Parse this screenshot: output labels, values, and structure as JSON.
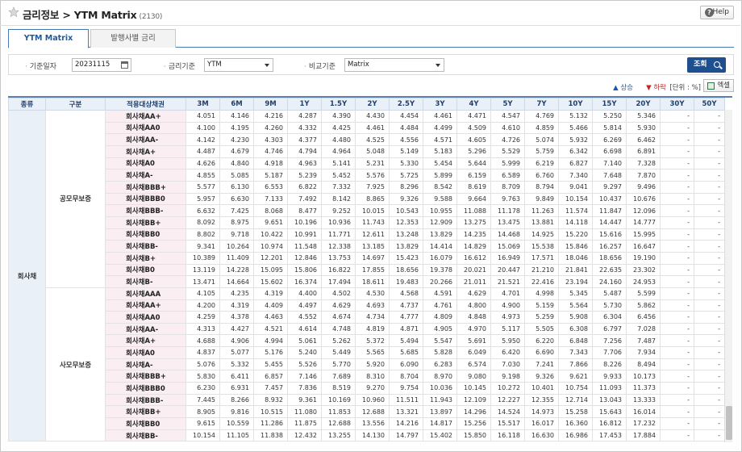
{
  "header": {
    "title": "금리정보 > YTM Matrix",
    "code": "(2130)",
    "help_label": "Help"
  },
  "tabs": [
    {
      "label": "YTM Matrix",
      "active": true
    },
    {
      "label": "발행사별 금리",
      "active": false
    }
  ],
  "filters": {
    "date_label": "기준일자",
    "date_value": "20231115",
    "rate_label": "금리기준",
    "rate_value": "YTM",
    "compare_label": "비교기준",
    "compare_value": "Matrix",
    "search_label": "조회"
  },
  "legend": {
    "up": "▲ 상승",
    "down": "▼ 하락",
    "unit": "[단위 : %]",
    "excel_label": "엑셀"
  },
  "colors": {
    "accent": "#1e4f8f",
    "header_bg": "#eaf0f8",
    "bond_bg": "#fbeef3",
    "up": "#1e56b4",
    "down": "#c82222"
  },
  "table": {
    "columns": [
      "종류",
      "구분",
      "적용대상채권",
      "3M",
      "6M",
      "9M",
      "1Y",
      "1.5Y",
      "2Y",
      "2.5Y",
      "3Y",
      "4Y",
      "5Y",
      "7Y",
      "10Y",
      "15Y",
      "20Y",
      "30Y",
      "50Y"
    ],
    "kind": "회사채",
    "groups": [
      {
        "name": "공모무보증",
        "rows": [
          {
            "bond": "회사채AA+",
            "values": [
              "4.051",
              "4.146",
              "4.216",
              "4.287",
              "4.390",
              "4.430",
              "4.454",
              "4.461",
              "4.471",
              "4.547",
              "4.769",
              "5.132",
              "5.250",
              "5.346",
              "-",
              "-"
            ]
          },
          {
            "bond": "회사채AA0",
            "values": [
              "4.100",
              "4.195",
              "4.260",
              "4.332",
              "4.425",
              "4.461",
              "4.484",
              "4.499",
              "4.509",
              "4.610",
              "4.859",
              "5.466",
              "5.814",
              "5.930",
              "-",
              "-"
            ]
          },
          {
            "bond": "회사채AA-",
            "values": [
              "4.142",
              "4.230",
              "4.303",
              "4.377",
              "4.480",
              "4.525",
              "4.556",
              "4.571",
              "4.605",
              "4.726",
              "5.074",
              "5.932",
              "6.269",
              "6.462",
              "-",
              "-"
            ]
          },
          {
            "bond": "회사채A+",
            "values": [
              "4.487",
              "4.679",
              "4.746",
              "4.794",
              "4.964",
              "5.048",
              "5.149",
              "5.183",
              "5.296",
              "5.529",
              "5.759",
              "6.342",
              "6.698",
              "6.891",
              "-",
              "-"
            ]
          },
          {
            "bond": "회사채A0",
            "values": [
              "4.626",
              "4.840",
              "4.918",
              "4.963",
              "5.141",
              "5.231",
              "5.330",
              "5.454",
              "5.644",
              "5.999",
              "6.219",
              "6.827",
              "7.140",
              "7.328",
              "-",
              "-"
            ]
          },
          {
            "bond": "회사채A-",
            "values": [
              "4.855",
              "5.085",
              "5.187",
              "5.239",
              "5.452",
              "5.576",
              "5.725",
              "5.899",
              "6.159",
              "6.589",
              "6.760",
              "7.340",
              "7.648",
              "7.870",
              "-",
              "-"
            ]
          },
          {
            "bond": "회사채BBB+",
            "values": [
              "5.577",
              "6.130",
              "6.553",
              "6.822",
              "7.332",
              "7.925",
              "8.296",
              "8.542",
              "8.619",
              "8.709",
              "8.794",
              "9.041",
              "9.297",
              "9.496",
              "-",
              "-"
            ]
          },
          {
            "bond": "회사채BBB0",
            "values": [
              "5.957",
              "6.630",
              "7.133",
              "7.492",
              "8.142",
              "8.865",
              "9.326",
              "9.588",
              "9.664",
              "9.763",
              "9.849",
              "10.154",
              "10.437",
              "10.676",
              "-",
              "-"
            ]
          },
          {
            "bond": "회사채BBB-",
            "values": [
              "6.632",
              "7.425",
              "8.068",
              "8.477",
              "9.252",
              "10.015",
              "10.543",
              "10.955",
              "11.088",
              "11.178",
              "11.263",
              "11.574",
              "11.847",
              "12.096",
              "-",
              "-"
            ]
          },
          {
            "bond": "회사채BB+",
            "values": [
              "8.092",
              "8.975",
              "9.651",
              "10.196",
              "10.936",
              "11.743",
              "12.353",
              "12.909",
              "13.275",
              "13.475",
              "13.881",
              "14.118",
              "14.447",
              "14.777",
              "-",
              "-"
            ]
          },
          {
            "bond": "회사채BB0",
            "values": [
              "8.802",
              "9.718",
              "10.422",
              "10.991",
              "11.771",
              "12.611",
              "13.248",
              "13.829",
              "14.235",
              "14.468",
              "14.925",
              "15.220",
              "15.616",
              "15.995",
              "-",
              "-"
            ]
          },
          {
            "bond": "회사채BB-",
            "values": [
              "9.341",
              "10.264",
              "10.974",
              "11.548",
              "12.338",
              "13.185",
              "13.829",
              "14.414",
              "14.829",
              "15.069",
              "15.538",
              "15.846",
              "16.257",
              "16.647",
              "-",
              "-"
            ]
          },
          {
            "bond": "회사채B+",
            "values": [
              "10.389",
              "11.409",
              "12.201",
              "12.846",
              "13.753",
              "14.697",
              "15.423",
              "16.079",
              "16.612",
              "16.949",
              "17.571",
              "18.046",
              "18.656",
              "19.190",
              "-",
              "-"
            ]
          },
          {
            "bond": "회사채B0",
            "values": [
              "13.119",
              "14.228",
              "15.095",
              "15.806",
              "16.822",
              "17.855",
              "18.656",
              "19.378",
              "20.021",
              "20.447",
              "21.210",
              "21.841",
              "22.635",
              "23.302",
              "-",
              "-"
            ]
          },
          {
            "bond": "회사채B-",
            "values": [
              "13.471",
              "14.664",
              "15.602",
              "16.374",
              "17.494",
              "18.611",
              "19.483",
              "20.266",
              "21.011",
              "21.521",
              "22.416",
              "23.194",
              "24.160",
              "24.953",
              "-",
              "-"
            ]
          }
        ]
      },
      {
        "name": "사모무보증",
        "rows": [
          {
            "bond": "회사채AAA",
            "values": [
              "4.105",
              "4.235",
              "4.319",
              "4.400",
              "4.502",
              "4.530",
              "4.568",
              "4.591",
              "4.629",
              "4.701",
              "4.998",
              "5.345",
              "5.487",
              "5.599",
              "-",
              "-"
            ]
          },
          {
            "bond": "회사채AA+",
            "values": [
              "4.200",
              "4.319",
              "4.409",
              "4.497",
              "4.629",
              "4.693",
              "4.737",
              "4.761",
              "4.800",
              "4.900",
              "5.159",
              "5.564",
              "5.730",
              "5.862",
              "-",
              "-"
            ]
          },
          {
            "bond": "회사채AA0",
            "values": [
              "4.259",
              "4.378",
              "4.463",
              "4.552",
              "4.674",
              "4.734",
              "4.777",
              "4.809",
              "4.848",
              "4.973",
              "5.259",
              "5.908",
              "6.304",
              "6.456",
              "-",
              "-"
            ]
          },
          {
            "bond": "회사채AA-",
            "values": [
              "4.313",
              "4.427",
              "4.521",
              "4.614",
              "4.748",
              "4.819",
              "4.871",
              "4.905",
              "4.970",
              "5.117",
              "5.505",
              "6.308",
              "6.797",
              "7.028",
              "-",
              "-"
            ]
          },
          {
            "bond": "회사채A+",
            "values": [
              "4.688",
              "4.906",
              "4.994",
              "5.061",
              "5.262",
              "5.372",
              "5.494",
              "5.547",
              "5.691",
              "5.950",
              "6.220",
              "6.848",
              "7.256",
              "7.487",
              "-",
              "-"
            ]
          },
          {
            "bond": "회사채A0",
            "values": [
              "4.837",
              "5.077",
              "5.176",
              "5.240",
              "5.449",
              "5.565",
              "5.685",
              "5.828",
              "6.049",
              "6.420",
              "6.690",
              "7.343",
              "7.706",
              "7.934",
              "-",
              "-"
            ]
          },
          {
            "bond": "회사채A-",
            "values": [
              "5.076",
              "5.332",
              "5.455",
              "5.526",
              "5.770",
              "5.920",
              "6.090",
              "6.283",
              "6.574",
              "7.030",
              "7.241",
              "7.866",
              "8.226",
              "8.494",
              "-",
              "-"
            ]
          },
          {
            "bond": "회사채BBB+",
            "values": [
              "5.830",
              "6.411",
              "6.857",
              "7.146",
              "7.689",
              "8.310",
              "8.704",
              "8.970",
              "9.080",
              "9.198",
              "9.326",
              "9.621",
              "9.933",
              "10.173",
              "-",
              "-"
            ]
          },
          {
            "bond": "회사채BBB0",
            "values": [
              "6.230",
              "6.931",
              "7.457",
              "7.836",
              "8.519",
              "9.270",
              "9.754",
              "10.036",
              "10.145",
              "10.272",
              "10.401",
              "10.754",
              "11.093",
              "11.373",
              "-",
              "-"
            ]
          },
          {
            "bond": "회사채BBB-",
            "values": [
              "7.445",
              "8.266",
              "8.932",
              "9.361",
              "10.169",
              "10.960",
              "11.511",
              "11.943",
              "12.109",
              "12.227",
              "12.355",
              "12.714",
              "13.043",
              "13.333",
              "-",
              "-"
            ]
          },
          {
            "bond": "회사채BB+",
            "values": [
              "8.905",
              "9.816",
              "10.515",
              "11.080",
              "11.853",
              "12.688",
              "13.321",
              "13.897",
              "14.296",
              "14.524",
              "14.973",
              "15.258",
              "15.643",
              "16.014",
              "-",
              "-"
            ]
          },
          {
            "bond": "회사채BB0",
            "values": [
              "9.615",
              "10.559",
              "11.286",
              "11.875",
              "12.688",
              "13.556",
              "14.216",
              "14.817",
              "15.256",
              "15.517",
              "16.017",
              "16.360",
              "16.812",
              "17.232",
              "-",
              "-"
            ]
          },
          {
            "bond": "회사채BB-",
            "values": [
              "10.154",
              "11.105",
              "11.838",
              "12.432",
              "13.255",
              "14.130",
              "14.797",
              "15.402",
              "15.850",
              "16.118",
              "16.630",
              "16.986",
              "17.453",
              "17.884",
              "-",
              "-"
            ]
          }
        ]
      }
    ]
  }
}
